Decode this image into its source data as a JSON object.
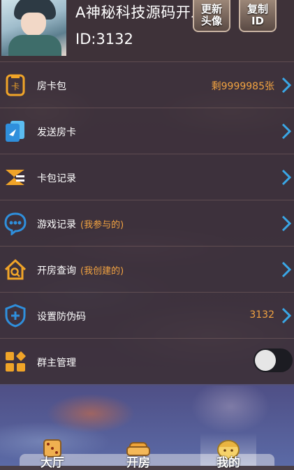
{
  "profile": {
    "username": "A神秘科技源码开发",
    "id_text": "ID:3132",
    "refresh_avatar_label": "更新\n头像",
    "copy_id_label": "复制\nID"
  },
  "menu": [
    {
      "label": "房卡包",
      "sub": "",
      "value": "剩9999985张",
      "icon": "card-wallet-icon"
    },
    {
      "label": "发送房卡",
      "sub": "",
      "value": "",
      "icon": "send-cards-icon"
    },
    {
      "label": "卡包记录",
      "sub": "",
      "value": "",
      "icon": "card-record-icon"
    },
    {
      "label": "游戏记录",
      "sub": "(我参与的)",
      "value": "",
      "icon": "game-record-icon"
    },
    {
      "label": "开房查询",
      "sub": "(我创建的)",
      "value": "",
      "icon": "room-query-icon"
    },
    {
      "label": "设置防伪码",
      "sub": "",
      "value": "3132",
      "icon": "shield-plus-icon"
    },
    {
      "label": "群主管理",
      "sub": "",
      "value": "",
      "icon": "group-admin-icon",
      "toggle": false
    }
  ],
  "nav": [
    {
      "label": "大厅",
      "icon": "dice-icon"
    },
    {
      "label": "开房",
      "icon": "sofa-icon"
    },
    {
      "label": "我的",
      "icon": "user-face-icon",
      "active": true
    }
  ],
  "colors": {
    "accent": "#f2a341",
    "chevron": "#3aa7e6",
    "icon_orange": "#f0a428",
    "icon_blue": "#2f8fdc"
  }
}
